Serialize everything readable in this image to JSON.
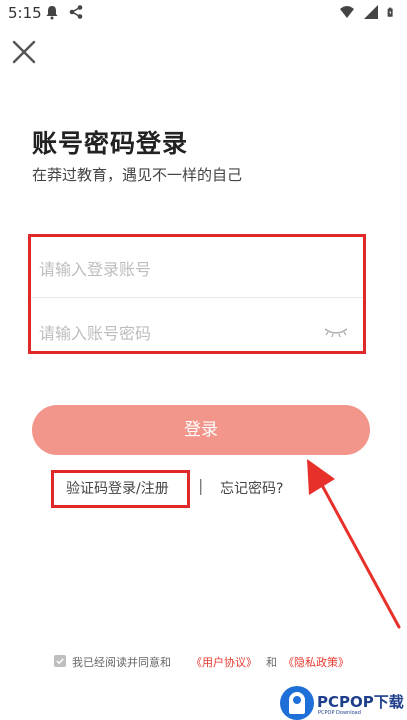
{
  "status_bar": {
    "time": "5:15",
    "left_icons": [
      "notification-bell-icon",
      "share-icon"
    ],
    "right_icons": [
      "wifi-icon",
      "signal-icon",
      "battery-icon"
    ]
  },
  "header": {
    "close_icon": "close-icon"
  },
  "login": {
    "title": "账号密码登录",
    "subtitle": "在莽过教育，遇见不一样的自己",
    "account_placeholder": "请输入登录账号",
    "password_placeholder": "请输入账号密码",
    "login_label": "登录",
    "sms_login_label": "验证码登录/注册",
    "separator": "|",
    "forgot_label": "忘记密码?"
  },
  "agreement": {
    "checked": true,
    "text": "我已经阅读并同意和",
    "user_agreement": "《用户协议》",
    "and": "和",
    "privacy_policy": "《隐私政策》"
  },
  "watermark": {
    "text": "PCPOP下载",
    "sub": "PCPOP Download"
  },
  "colors": {
    "accent": "#f2958a",
    "highlight_border": "#e02828",
    "link": "#e53b2f"
  }
}
